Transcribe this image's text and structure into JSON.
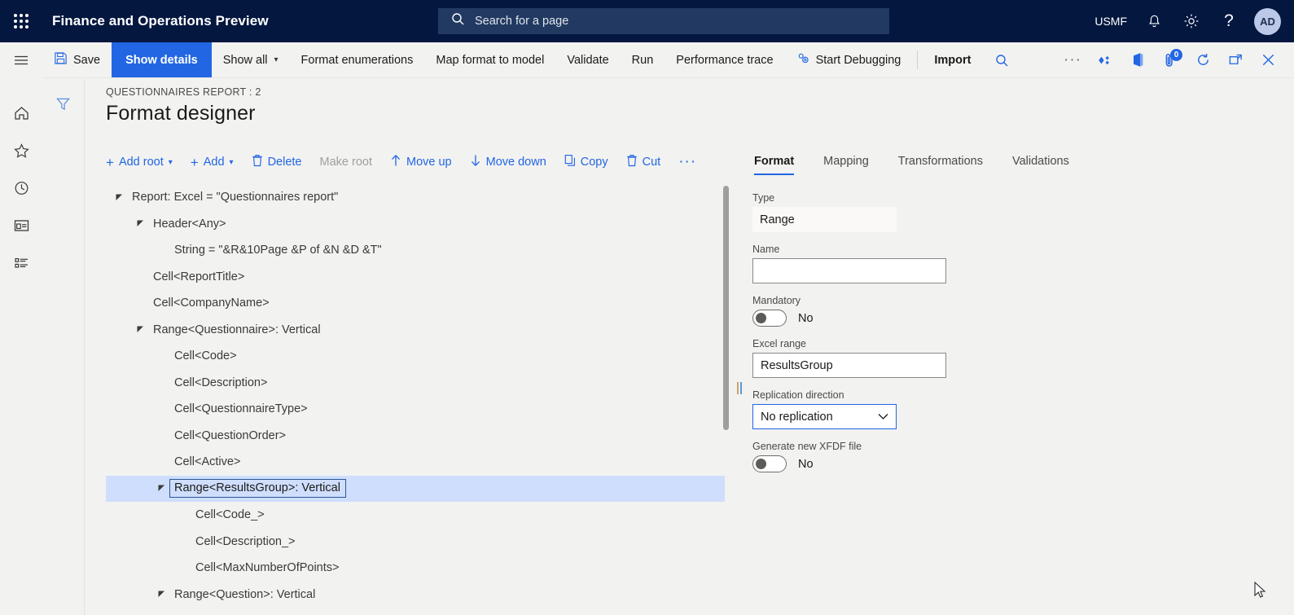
{
  "header": {
    "app_title": "Finance and Operations Preview",
    "waffle_icon": "app-launcher-icon",
    "search": {
      "icon": "search-icon",
      "placeholder": "Search for a page",
      "value": ""
    },
    "company": "USMF",
    "notifications_icon": "bell-icon",
    "settings_icon": "gear-icon",
    "help_icon": "question-mark-icon",
    "avatar_initials": "AD"
  },
  "rail": {
    "items": [
      {
        "name": "hamburger-menu",
        "icon": "hamburger-icon"
      },
      {
        "name": "home",
        "icon": "home-icon"
      },
      {
        "name": "favorites",
        "icon": "star-icon"
      },
      {
        "name": "recent",
        "icon": "clock-icon"
      },
      {
        "name": "workspaces",
        "icon": "workspace-icon"
      },
      {
        "name": "modules",
        "icon": "modules-list-icon"
      }
    ]
  },
  "command_bar": {
    "save": {
      "label": "Save",
      "icon": "save-disk-icon"
    },
    "show_details": {
      "label": "Show details"
    },
    "show_all": {
      "label": "Show all",
      "icon": "chevron-down-icon"
    },
    "format_enumerations": {
      "label": "Format enumerations"
    },
    "map_format_to_model": {
      "label": "Map format to model"
    },
    "validate": {
      "label": "Validate"
    },
    "run": {
      "label": "Run"
    },
    "performance_trace": {
      "label": "Performance trace"
    },
    "start_debugging": {
      "label": "Start Debugging",
      "icon": "debug-gears-icon"
    },
    "import": {
      "label": "Import"
    },
    "search_icon": "search-icon",
    "right_icons": [
      {
        "name": "overflow-menu",
        "icon": "ellipsis-icon"
      },
      {
        "name": "share",
        "icon": "share-diamond-icon"
      },
      {
        "name": "open-in-office",
        "icon": "office-icon"
      },
      {
        "name": "attachments",
        "icon": "paperclip-icon",
        "badge": "0"
      },
      {
        "name": "refresh",
        "icon": "refresh-icon"
      },
      {
        "name": "popout",
        "icon": "open-in-new-window-icon"
      },
      {
        "name": "close",
        "icon": "close-x-icon"
      }
    ]
  },
  "filter_icon": "filter-funnel-icon",
  "page": {
    "breadcrumb": "QUESTIONNAIRES REPORT : 2",
    "title": "Format designer"
  },
  "tree_toolbar": {
    "items": [
      {
        "label": "Add root",
        "icon": "plus-icon",
        "chevron": "chevron-down-icon",
        "disabled": false
      },
      {
        "label": "Add",
        "icon": "plus-icon",
        "chevron": "chevron-down-icon",
        "disabled": false
      },
      {
        "label": "Delete",
        "icon": "trash-icon",
        "disabled": false
      },
      {
        "label": "Make root",
        "icon": "",
        "disabled": true
      },
      {
        "label": "Move up",
        "icon": "arrow-up-icon",
        "disabled": false
      },
      {
        "label": "Move down",
        "icon": "arrow-down-icon",
        "disabled": false
      },
      {
        "label": "Copy",
        "icon": "copy-icon",
        "disabled": false
      },
      {
        "label": "Cut",
        "icon": "cut-trash-icon",
        "disabled": false
      },
      {
        "label": "···",
        "icon": "ellipsis-icon",
        "disabled": false
      }
    ]
  },
  "tree": {
    "nodes": [
      {
        "label": "Report: Excel = \"Questionnaires report\"",
        "indent": 0,
        "expander": "expanded",
        "selected": false
      },
      {
        "label": "Header<Any>",
        "indent": 1,
        "expander": "expanded",
        "selected": false
      },
      {
        "label": "String = \"&R&10Page &P of &N &D &T\"",
        "indent": 2,
        "expander": "none",
        "selected": false
      },
      {
        "label": "Cell<ReportTitle>",
        "indent": 1,
        "expander": "none",
        "selected": false
      },
      {
        "label": "Cell<CompanyName>",
        "indent": 1,
        "expander": "none",
        "selected": false
      },
      {
        "label": "Range<Questionnaire>: Vertical",
        "indent": 1,
        "expander": "expanded",
        "selected": false
      },
      {
        "label": "Cell<Code>",
        "indent": 2,
        "expander": "none",
        "selected": false
      },
      {
        "label": "Cell<Description>",
        "indent": 2,
        "expander": "none",
        "selected": false
      },
      {
        "label": "Cell<QuestionnaireType>",
        "indent": 2,
        "expander": "none",
        "selected": false
      },
      {
        "label": "Cell<QuestionOrder>",
        "indent": 2,
        "expander": "none",
        "selected": false
      },
      {
        "label": "Cell<Active>",
        "indent": 2,
        "expander": "none",
        "selected": false
      },
      {
        "label": "Range<ResultsGroup>: Vertical",
        "indent": 2,
        "expander": "expanded",
        "selected": true
      },
      {
        "label": "Cell<Code_>",
        "indent": 3,
        "expander": "none",
        "selected": false
      },
      {
        "label": "Cell<Description_>",
        "indent": 3,
        "expander": "none",
        "selected": false
      },
      {
        "label": "Cell<MaxNumberOfPoints>",
        "indent": 3,
        "expander": "none",
        "selected": false
      },
      {
        "label": "Range<Question>: Vertical",
        "indent": 2,
        "expander": "expanded",
        "selected": false
      }
    ]
  },
  "property_panel": {
    "tabs": [
      {
        "label": "Format",
        "active": true
      },
      {
        "label": "Mapping",
        "active": false
      },
      {
        "label": "Transformations",
        "active": false
      },
      {
        "label": "Validations",
        "active": false
      }
    ],
    "fields": {
      "type": {
        "label": "Type",
        "value": "Range"
      },
      "name": {
        "label": "Name",
        "value": "",
        "placeholder": ""
      },
      "mandatory": {
        "label": "Mandatory",
        "value": "No",
        "state": "off"
      },
      "excel_range": {
        "label": "Excel range",
        "value": "ResultsGroup"
      },
      "replication_direction": {
        "label": "Replication direction",
        "value": "No replication",
        "chevron": "chevron-down-icon"
      },
      "generate_xfdf": {
        "label": "Generate new XFDF file",
        "value": "No",
        "state": "off"
      }
    }
  },
  "colors": {
    "nav_bar": "#03173f",
    "accent": "#2266e3",
    "page_bg": "#f2f2f1",
    "selection": "#cfdefc",
    "selection_border": "#2b579a"
  }
}
